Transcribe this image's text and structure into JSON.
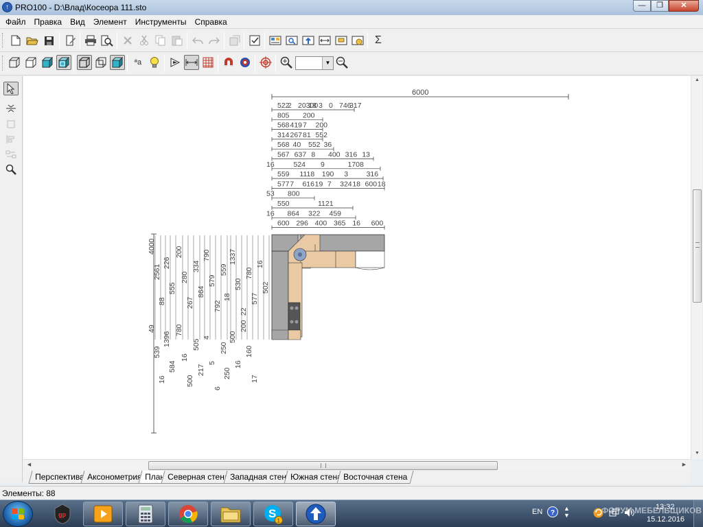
{
  "window": {
    "title": "PRO100 - D:\\Влад\\Косеора 111.sto",
    "app_icon": "pro100-logo",
    "controls": [
      "minimize-icon",
      "maximize-icon",
      "close-icon"
    ],
    "minimize_glyph": "—",
    "maximize_glyph": "❐",
    "close_glyph": "✕"
  },
  "menu": {
    "items": [
      "Файл",
      "Правка",
      "Вид",
      "Элемент",
      "Инструменты",
      "Справка"
    ]
  },
  "toolbar1": {
    "buttons": [
      "new-file-icon",
      "open-folder-icon",
      "save-icon",
      "properties-icon",
      "print-icon",
      "print-preview-icon",
      "delete-icon",
      "cut-icon",
      "copy-icon",
      "paste-icon",
      "undo-icon",
      "redo-icon",
      "element-properties-icon",
      "checklist-icon",
      "catalog-icon",
      "report-preview-icon",
      "upload-icon",
      "dimensions-icon",
      "export-icon",
      "settings-icon",
      "sum-icon"
    ],
    "sum_glyph": "Σ"
  },
  "toolbar2": {
    "buttons": [
      "wireframe-view-icon",
      "hidden-lines-icon",
      "shaded-view-icon",
      "textured-view-icon",
      "front-box-icon",
      "back-box-icon",
      "solid-box-icon",
      "text-size-icon",
      "light-bulb-icon",
      "snap-icon",
      "auto-dimensions-icon",
      "grid-icon",
      "magnet-icon",
      "target-icon",
      "crosshair-icon",
      "zoom-in-icon",
      "zoom-out-icon"
    ],
    "text_size_glyph": "ªa",
    "zoom_value": ""
  },
  "left_tools": [
    "select-arrow-icon",
    "mirror-icon",
    "rotate-icon",
    "align-icon",
    "distribute-icon",
    "zoom-tool-icon"
  ],
  "plan": {
    "top_dimension": "6000",
    "dim_rows": [
      [
        "522",
        "2",
        "20300",
        "18",
        "3",
        "0",
        "746",
        "317"
      ],
      [
        "805",
        "200"
      ],
      [
        "568",
        "419",
        "7",
        "200"
      ],
      [
        "314",
        "267",
        "81",
        "552"
      ],
      [
        "568",
        "40",
        "552",
        "36"
      ],
      [
        "567",
        "637",
        "8",
        "400",
        "316",
        "13"
      ],
      [
        "16",
        "524",
        "9",
        "1708"
      ],
      [
        "559",
        "1118",
        "190",
        "3",
        "316"
      ],
      [
        "577",
        "7",
        "616",
        "19",
        "7",
        "324",
        "18",
        "600",
        "18"
      ],
      [
        "53",
        "800"
      ],
      [
        "550",
        "1121"
      ],
      [
        "16",
        "864",
        "322",
        "459"
      ],
      [
        "600",
        "296",
        "400",
        "365",
        "16",
        "600"
      ]
    ],
    "vertical_labels": [
      "4000",
      "2561",
      "88",
      "226",
      "555",
      "200",
      "280",
      "267",
      "334",
      "864",
      "790",
      "579",
      "792",
      "559",
      "18",
      "1337",
      "530",
      "22",
      "780",
      "577",
      "16",
      "502",
      "49",
      "539",
      "16",
      "1396",
      "584",
      "780",
      "16",
      "500",
      "505",
      "217",
      "4",
      "5",
      "6",
      "250",
      "250",
      "500",
      "16",
      "200",
      "160",
      "17"
    ],
    "wall_color": "#a6a6a6",
    "floor_color": "#e9caa4",
    "sink_color": "#8ea4c8"
  },
  "tabs": [
    "Перспектива",
    "Аксонометрия",
    "План",
    "Северная стена",
    "Западная стена",
    "Южная стена",
    "Восточная стена"
  ],
  "active_tab": "План",
  "status": {
    "elements_label": "Элементы: 88"
  },
  "taskbar": {
    "start": "windows-start-icon",
    "apps": [
      "gp-app-icon",
      "media-player-icon",
      "calculator-icon",
      "chrome-icon",
      "file-explorer-icon",
      "skype-icon",
      "pro100-app-icon"
    ],
    "skype_badge": "1",
    "language": "EN",
    "help_glyph": "?",
    "watermark": "ФОРУМ МЕБЕЛЬЩИКОВ",
    "time": "13:32",
    "date": "15.12.2016"
  }
}
